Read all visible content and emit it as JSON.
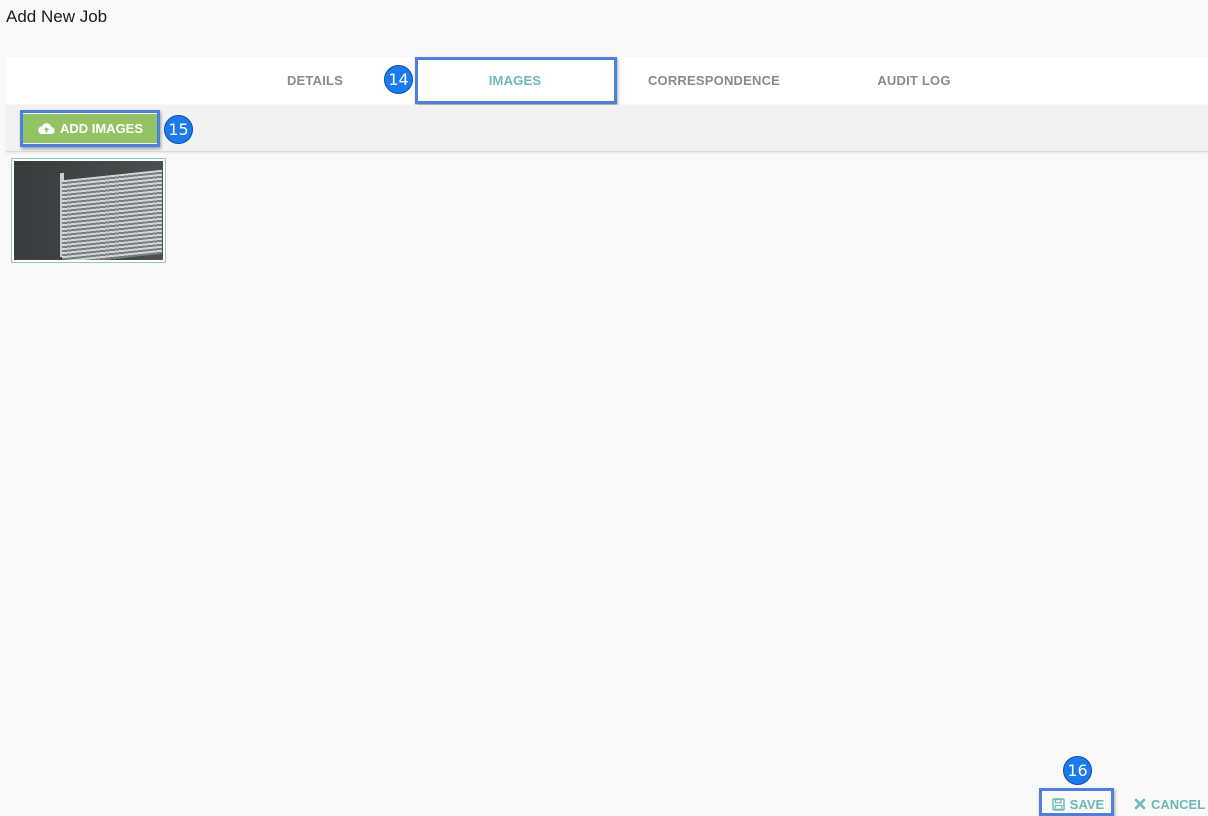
{
  "page": {
    "title": "Add New Job"
  },
  "tabs": [
    {
      "label": "DETAILS",
      "active": false
    },
    {
      "label": "IMAGES",
      "active": true
    },
    {
      "label": "CORRESPONDENCE",
      "active": false
    },
    {
      "label": "AUDIT LOG",
      "active": false
    }
  ],
  "toolbar": {
    "add_images_label": "ADD IMAGES",
    "add_icon": "cloud-upload-icon"
  },
  "gallery": {
    "images": [
      {
        "thumbnail_icon": "photo-thumbnail"
      }
    ]
  },
  "footer": {
    "save_label": "SAVE",
    "save_icon": "floppy-disk-icon",
    "cancel_label": "CANCEL",
    "cancel_icon": "close-icon"
  },
  "callouts": {
    "tab_images": "14",
    "add_images": "15",
    "save": "16"
  },
  "colors": {
    "accent_teal": "#6bb8b5",
    "button_green": "#93c364",
    "callout_blue": "#1a7aee"
  }
}
